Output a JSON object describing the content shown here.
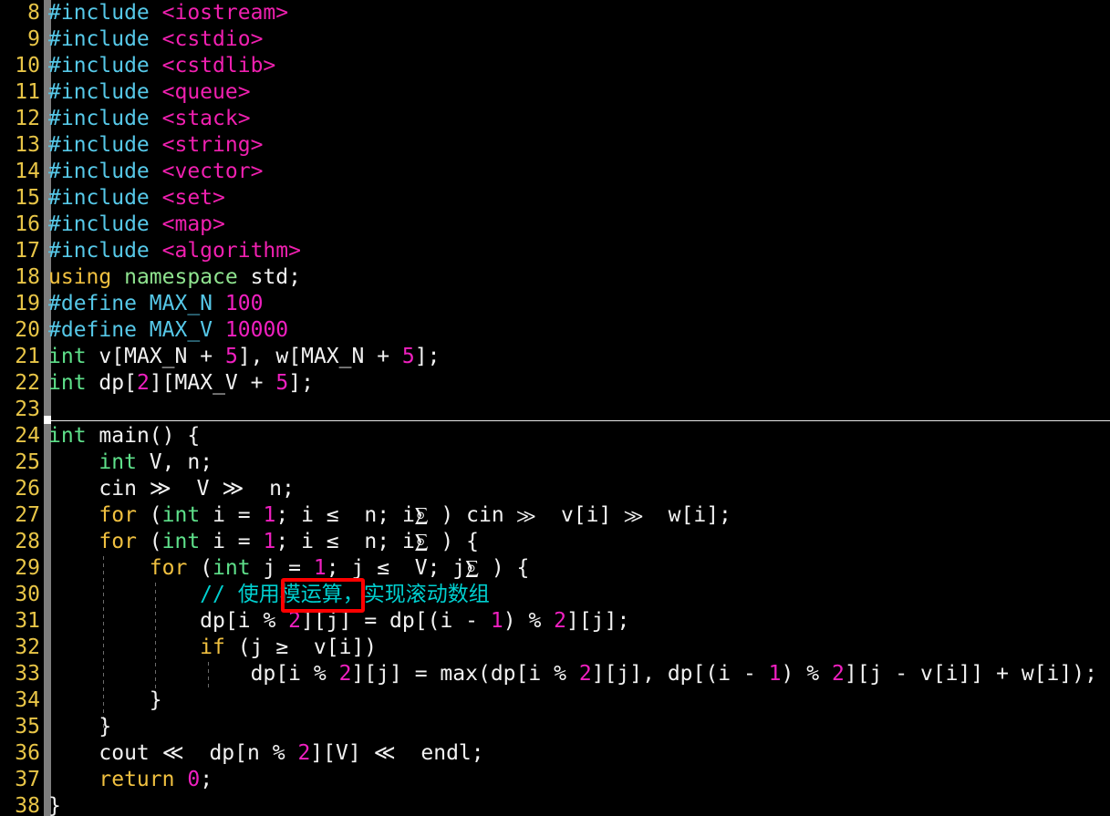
{
  "editor": {
    "background_color": "#000000",
    "line_number_color": "#e8c547",
    "first_line": 8,
    "last_line": 38,
    "language": "C++",
    "font_size_px": 23,
    "line_height_px": 29
  },
  "annotation": {
    "type": "red-rectangle-highlight",
    "color": "#ff0000",
    "highlighted_text": "模运算",
    "on_line": 30
  },
  "lines": [
    {
      "num": "8",
      "text": "#include <iostream>"
    },
    {
      "num": "9",
      "text": "#include <cstdio>"
    },
    {
      "num": "10",
      "text": "#include <cstdlib>"
    },
    {
      "num": "11",
      "text": "#include <queue>"
    },
    {
      "num": "12",
      "text": "#include <stack>"
    },
    {
      "num": "13",
      "text": "#include <string>"
    },
    {
      "num": "14",
      "text": "#include <vector>"
    },
    {
      "num": "15",
      "text": "#include <set>"
    },
    {
      "num": "16",
      "text": "#include <map>"
    },
    {
      "num": "17",
      "text": "#include <algorithm>"
    },
    {
      "num": "18",
      "text": "using namespace std;"
    },
    {
      "num": "19",
      "text": "#define MAX_N 100"
    },
    {
      "num": "20",
      "text": "#define MAX_V 10000"
    },
    {
      "num": "21",
      "text": "int v[MAX_N + 5], w[MAX_N + 5];"
    },
    {
      "num": "22",
      "text": "int dp[2][MAX_V + 5];"
    },
    {
      "num": "23",
      "text": ""
    },
    {
      "num": "24",
      "text": "int main() {"
    },
    {
      "num": "25",
      "text": "    int V, n;"
    },
    {
      "num": "26",
      "text": "    cin >> V >> n;"
    },
    {
      "num": "27",
      "text": "    for (int i = 1; i <= n; i++) cin >> v[i] >> w[i];"
    },
    {
      "num": "28",
      "text": "    for (int i = 1; i <= n; i++) {"
    },
    {
      "num": "29",
      "text": "        for (int j = 1; j <= V; j++) {"
    },
    {
      "num": "30",
      "text": "            // 使用模运算，实现滚动数组"
    },
    {
      "num": "31",
      "text": "            dp[i % 2][j] = dp[(i - 1) % 2][j];"
    },
    {
      "num": "32",
      "text": "            if (j >= v[i])"
    },
    {
      "num": "33",
      "text": "                dp[i % 2][j] = max(dp[i % 2][j], dp[(i - 1) % 2][j - v[i]] + w[i]);"
    },
    {
      "num": "34",
      "text": "        }"
    },
    {
      "num": "35",
      "text": "    }"
    },
    {
      "num": "36",
      "text": "    cout << dp[n % 2][V] << endl;"
    },
    {
      "num": "37",
      "text": "    return 0;"
    },
    {
      "num": "38",
      "text": "}"
    }
  ],
  "line_numbers": [
    "8",
    "9",
    "10",
    "11",
    "12",
    "13",
    "14",
    "15",
    "16",
    "17",
    "18",
    "19",
    "20",
    "21",
    "22",
    "23",
    "24",
    "25",
    "26",
    "27",
    "28",
    "29",
    "30",
    "31",
    "32",
    "33",
    "34",
    "35",
    "36",
    "37",
    "38"
  ]
}
